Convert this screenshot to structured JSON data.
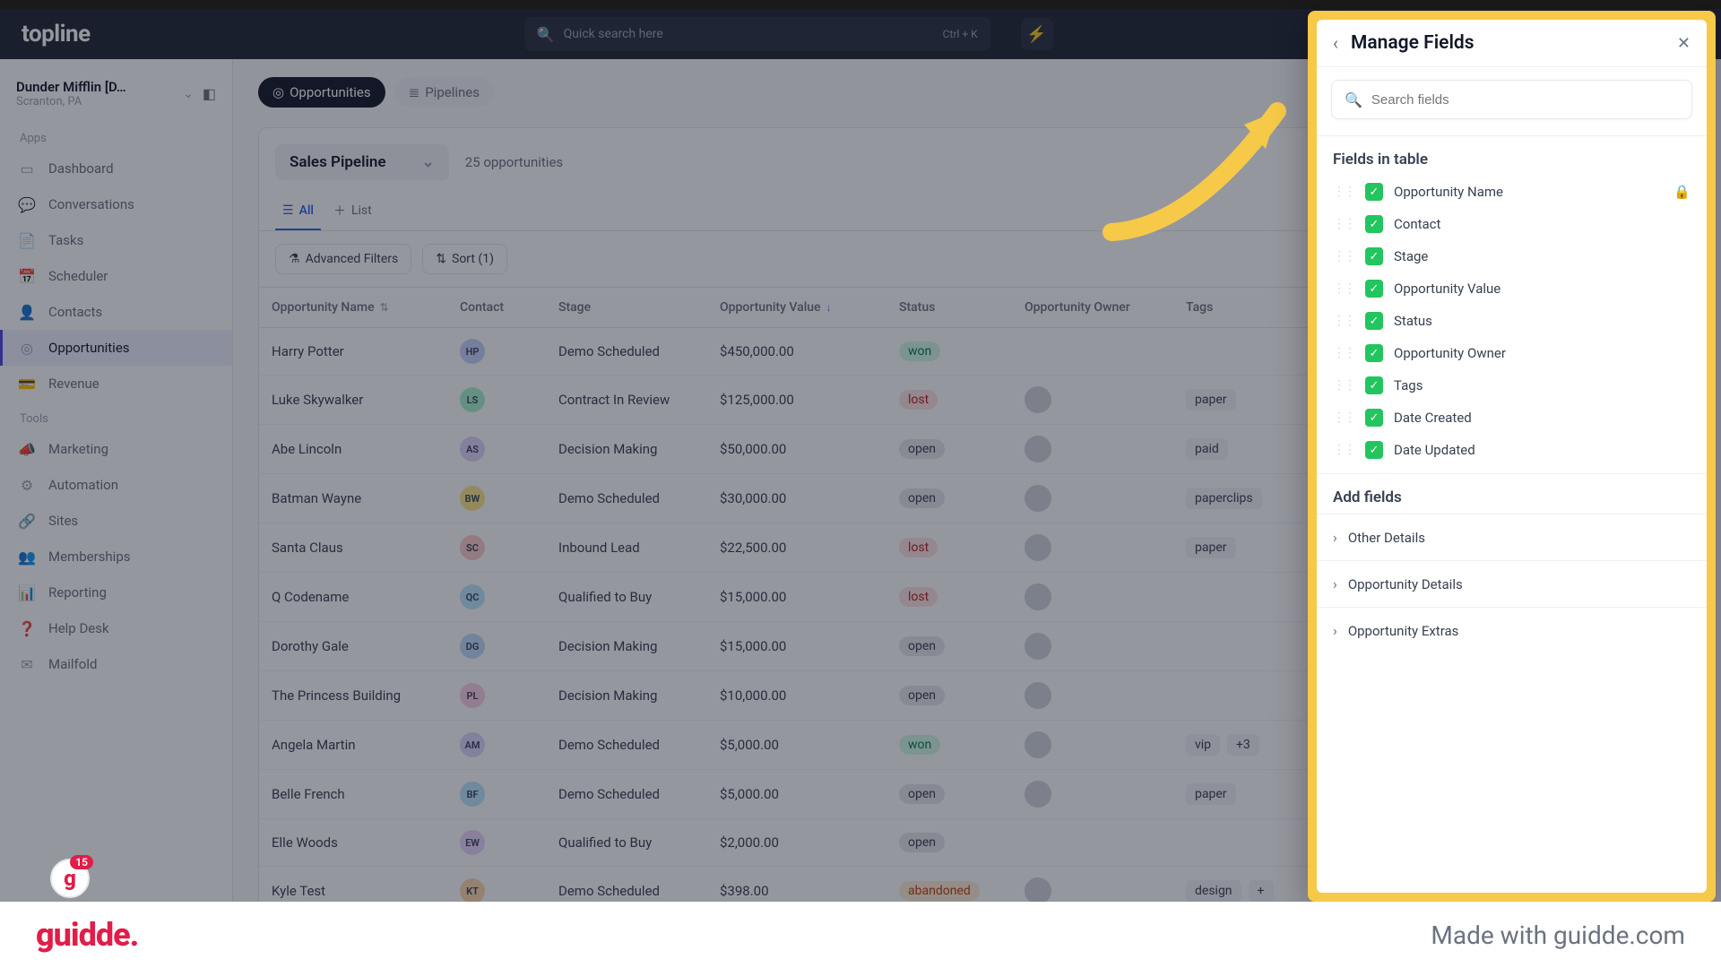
{
  "header": {
    "logo": "topline",
    "search_placeholder": "Quick search here",
    "shortcut": "Ctrl + K",
    "bolt": "⚡"
  },
  "org": {
    "name": "Dunder Mifflin [D…",
    "location": "Scranton, PA"
  },
  "sidebar": {
    "apps_label": "Apps",
    "tools_label": "Tools",
    "apps": [
      {
        "label": "Dashboard",
        "icon": "▭"
      },
      {
        "label": "Conversations",
        "icon": "💬"
      },
      {
        "label": "Tasks",
        "icon": "📄"
      },
      {
        "label": "Scheduler",
        "icon": "📅"
      },
      {
        "label": "Contacts",
        "icon": "👤"
      },
      {
        "label": "Opportunities",
        "icon": "◎",
        "active": true
      },
      {
        "label": "Revenue",
        "icon": "💳"
      }
    ],
    "tools": [
      {
        "label": "Marketing",
        "icon": "📣"
      },
      {
        "label": "Automation",
        "icon": "⚙"
      },
      {
        "label": "Sites",
        "icon": "🔗"
      },
      {
        "label": "Memberships",
        "icon": "👥"
      },
      {
        "label": "Reporting",
        "icon": "📊"
      },
      {
        "label": "Help Desk",
        "icon": "❓"
      },
      {
        "label": "Mailfold",
        "icon": "✉"
      }
    ]
  },
  "context": {
    "opportunities": "Opportunities",
    "pipelines": "Pipelines"
  },
  "card": {
    "pipeline": "Sales Pipeline",
    "count": "25 opportunities",
    "tabs": {
      "all": "All",
      "list": "List"
    },
    "filters": {
      "advanced": "Advanced Filters",
      "sort": "Sort (1)"
    }
  },
  "table": {
    "cols": [
      "Opportunity Name",
      "Contact",
      "Stage",
      "Opportunity Value",
      "Status",
      "Opportunity Owner",
      "Tags"
    ],
    "rows": [
      {
        "name": "Harry Potter",
        "initials": "HP",
        "chip": "#c7d2fe",
        "stage": "Demo Scheduled",
        "value": "$450,000.00",
        "status": "won",
        "owner": false,
        "tags": ""
      },
      {
        "name": "Luke Skywalker",
        "initials": "LS",
        "chip": "#a7f3d0",
        "stage": "Contract In Review",
        "value": "$125,000.00",
        "status": "lost",
        "owner": true,
        "tags": "paper"
      },
      {
        "name": "Abe Lincoln",
        "initials": "AS",
        "chip": "#ddd6fe",
        "stage": "Decision Making",
        "value": "$50,000.00",
        "status": "open",
        "owner": true,
        "tags": "paid"
      },
      {
        "name": "Batman Wayne",
        "initials": "BW",
        "chip": "#fde68a",
        "stage": "Demo Scheduled",
        "value": "$30,000.00",
        "status": "open",
        "owner": true,
        "tags": "paperclips"
      },
      {
        "name": "Santa Claus",
        "initials": "SC",
        "chip": "#fecaca",
        "stage": "Inbound Lead",
        "value": "$22,500.00",
        "status": "lost",
        "owner": true,
        "tags": "paper"
      },
      {
        "name": "Q Codename",
        "initials": "QC",
        "chip": "#bae6fd",
        "stage": "Qualified to Buy",
        "value": "$15,000.00",
        "status": "lost",
        "owner": true,
        "tags": ""
      },
      {
        "name": "Dorothy Gale",
        "initials": "DG",
        "chip": "#bfdbfe",
        "stage": "Decision Making",
        "value": "$15,000.00",
        "status": "open",
        "owner": true,
        "tags": ""
      },
      {
        "name": "The Princess Building",
        "initials": "PL",
        "chip": "#fbcfe8",
        "stage": "Decision Making",
        "value": "$10,000.00",
        "status": "open",
        "owner": true,
        "tags": ""
      },
      {
        "name": "Angela Martin",
        "initials": "AM",
        "chip": "#ddd6fe",
        "stage": "Demo Scheduled",
        "value": "$5,000.00",
        "status": "won",
        "owner": true,
        "tags": "vip",
        "extra": "+3"
      },
      {
        "name": "Belle French",
        "initials": "BF",
        "chip": "#bae6fd",
        "stage": "Demo Scheduled",
        "value": "$5,000.00",
        "status": "open",
        "owner": true,
        "tags": "paper"
      },
      {
        "name": "Elle Woods",
        "initials": "EW",
        "chip": "#e9d5ff",
        "stage": "Qualified to Buy",
        "value": "$2,000.00",
        "status": "open",
        "owner": false,
        "tags": ""
      },
      {
        "name": "Kyle Test",
        "initials": "KT",
        "chip": "#fed7aa",
        "stage": "Demo Scheduled",
        "value": "$398.00",
        "status": "abandoned",
        "owner": true,
        "tags": "design",
        "extra": "+"
      }
    ]
  },
  "panel": {
    "title": "Manage Fields",
    "search_placeholder": "Search fields",
    "fields_label": "Fields in table",
    "fields": [
      {
        "label": "Opportunity Name",
        "locked": true
      },
      {
        "label": "Contact"
      },
      {
        "label": "Stage"
      },
      {
        "label": "Opportunity Value"
      },
      {
        "label": "Status"
      },
      {
        "label": "Opportunity Owner"
      },
      {
        "label": "Tags"
      },
      {
        "label": "Date Created"
      },
      {
        "label": "Date Updated"
      }
    ],
    "add_label": "Add fields",
    "add_groups": [
      "Other Details",
      "Opportunity Details",
      "Opportunity Extras"
    ]
  },
  "badge": {
    "count": "15"
  },
  "footer": {
    "logo": "guidde.",
    "made": "Made with guidde.com"
  }
}
